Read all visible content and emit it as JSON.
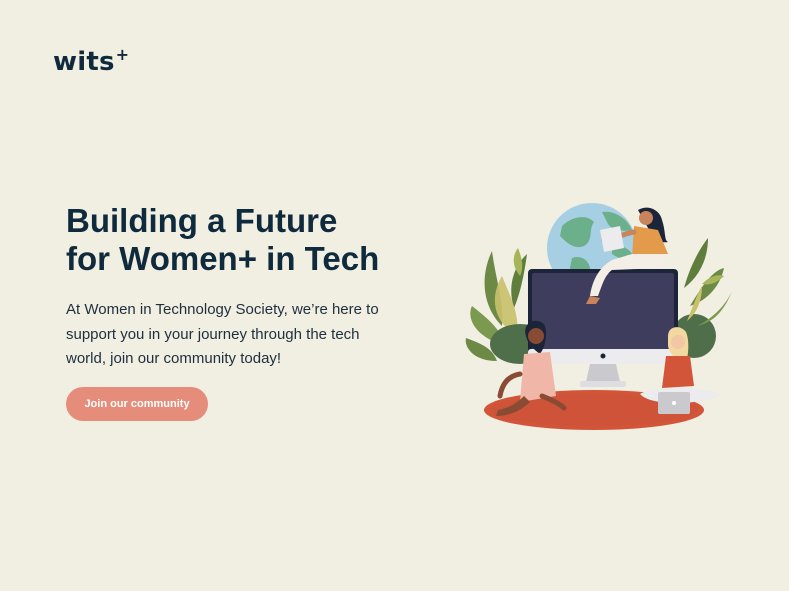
{
  "brand": {
    "name": "wits",
    "superscript": "+"
  },
  "hero": {
    "title": "Building a Future\nfor Women+ in Tech",
    "description": "At Women in Technology Society, we’re here to support you in your journey through the tech world, join our community today!",
    "cta_label": "Join our community"
  },
  "colors": {
    "background": "#f1eee2",
    "text_primary": "#0f2a3d",
    "accent": "#e58c7a",
    "illustration_base": "#d2553a",
    "monitor_screen": "#3e3d5e",
    "globe_ocean": "#a6cfe3",
    "globe_land": "#6bb08b"
  },
  "illustration": {
    "icon": "women-in-tech-illustration"
  }
}
